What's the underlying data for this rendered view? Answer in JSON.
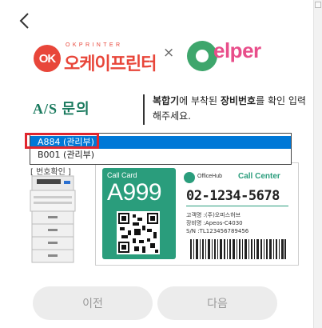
{
  "brands": {
    "partner_sub": "OKPRINTER",
    "partner_name": "오케이프린터",
    "separator": "×",
    "helper_name": "elper"
  },
  "as_inquiry": {
    "title": "A/S 문의",
    "instruction_bold1": "복합기",
    "instruction_text1": "에 부착된",
    "instruction_bold2": "장비번호",
    "instruction_text2": "를 확인 입력해주세요."
  },
  "device_select": {
    "options": [
      "A884 (관리부)",
      "B001 (관리부)"
    ],
    "selected": "A884 (관리부)"
  },
  "phone_check_label": "[ 번호확인 ]",
  "call_card": {
    "title": "Call Card",
    "number": "A999",
    "brand": "OfficeHub",
    "call_center_label": "Call Center",
    "phone": "02-1234-5678",
    "customer": "고객명 :(주)오피스허브",
    "equipment": "장비명 :Apeos-C4030",
    "serial": "S/N :TL123456789456"
  },
  "buttons": {
    "prev": "이전",
    "next": "다음"
  },
  "colors": {
    "brand_red": "#e8463a",
    "helper_green": "#3ea66c",
    "helper_pink": "#e84e8a",
    "card_green": "#2a9d7c",
    "select_blue": "#0078d7",
    "highlight_red": "#e0262e"
  }
}
